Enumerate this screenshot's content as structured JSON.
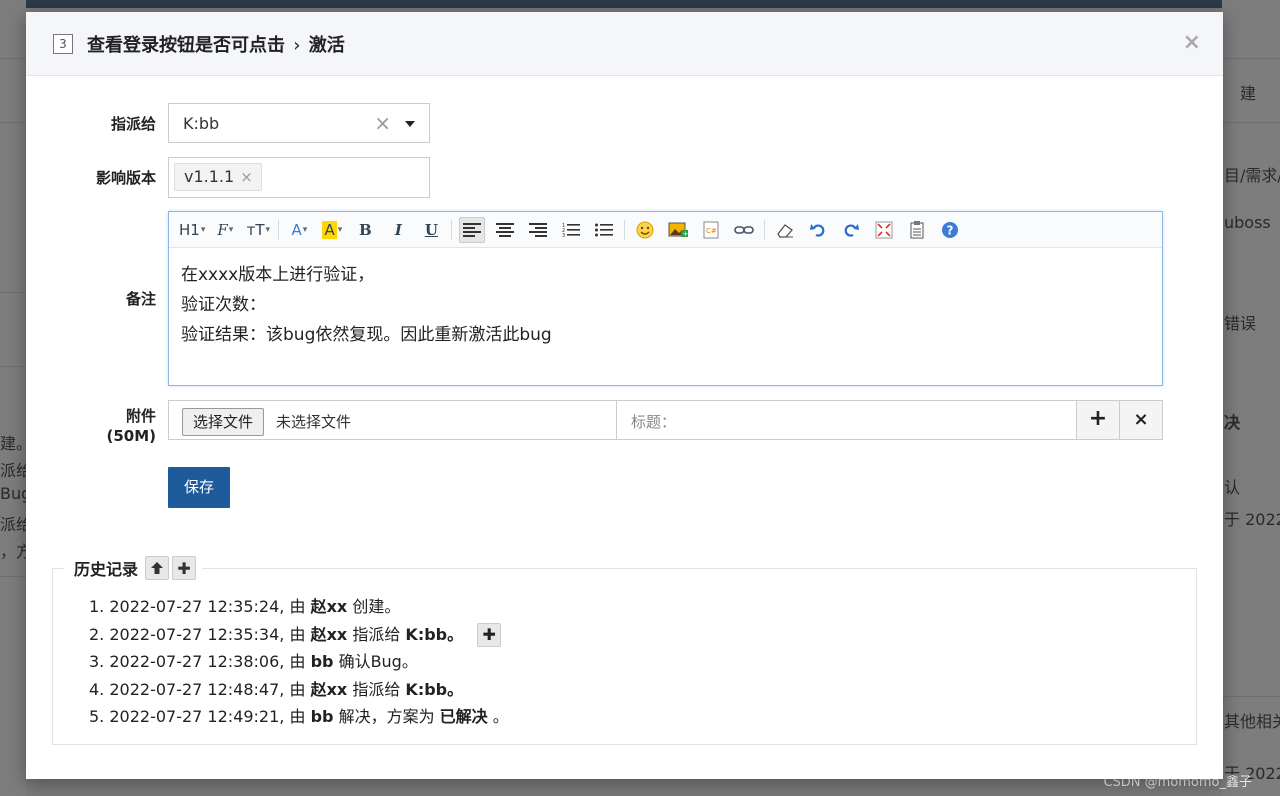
{
  "background": {
    "right_texts": [
      "建",
      "目/需求/任",
      "uboss",
      "错误",
      "决",
      "认",
      "于 2022",
      "其他相关",
      "于 2022"
    ],
    "left_texts": [
      "建。",
      "派给",
      "Bug",
      "派给",
      "，方"
    ],
    "watermark": "CSDN @momomo_鑫子"
  },
  "modal": {
    "id": "3",
    "title": "查看登录按钮是否可点击",
    "separator": "›",
    "action": "激活",
    "close": "×"
  },
  "form": {
    "assign_label": "指派给",
    "assign_value": "K:bb",
    "assign_clear": "×",
    "version_label": "影响版本",
    "version_tag": "v1.1.1",
    "version_tag_remove": "×",
    "comment_label": "备注",
    "comment_lines": [
      "在xxxx版本上进行验证，",
      "验证次数：",
      "验证结果：该bug依然复现。因此重新激活此bug"
    ],
    "attach_label": "附件",
    "attach_size": "(50M)",
    "file_button": "选择文件",
    "file_none": "未选择文件",
    "file_title_placeholder": "标题：",
    "file_add": "+",
    "file_remove": "×",
    "save": "保存"
  },
  "toolbar": {
    "h1": "H1",
    "font": "𝓕",
    "size": "тT",
    "font_color": "A",
    "bg_color": "A",
    "bold": "B",
    "italic": "I",
    "underline": "U"
  },
  "history": {
    "title": "历史记录",
    "items": [
      {
        "time": "1. 2022-07-27 12:35:24, 由",
        "user": "赵xx",
        "action": "创建。",
        "target": ""
      },
      {
        "time": "2. 2022-07-27 12:35:34, 由",
        "user": "赵xx",
        "action": "指派给",
        "target": "K:bb。"
      },
      {
        "time": "3. 2022-07-27 12:38:06, 由",
        "user": "bb",
        "action": "确认Bug。",
        "target": ""
      },
      {
        "time": "4. 2022-07-27 12:48:47, 由",
        "user": "赵xx",
        "action": "指派给",
        "target": "K:bb。"
      },
      {
        "time": "5. 2022-07-27 12:49:21, 由",
        "user": "bb",
        "action": "解决，方案为",
        "target": "已解决",
        "suffix": "。"
      }
    ]
  }
}
